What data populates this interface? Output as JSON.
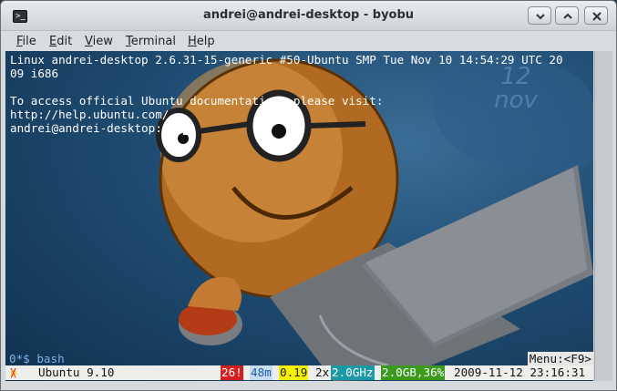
{
  "window": {
    "title": "andrei@andrei-desktop - byobu",
    "icon": "terminal-icon"
  },
  "menubar": {
    "items": [
      {
        "mnemonic": "F",
        "rest": "ile"
      },
      {
        "mnemonic": "E",
        "rest": "dit"
      },
      {
        "mnemonic": "V",
        "rest": "iew"
      },
      {
        "mnemonic": "T",
        "rest": "erminal"
      },
      {
        "mnemonic": "H",
        "rest": "elp"
      }
    ]
  },
  "terminal": {
    "lines": [
      "Linux andrei-desktop 2.6.31-15-generic #50-Ubuntu SMP Tue Nov 10 14:54:29 UTC 20",
      "09 i686",
      "",
      "To access official Ubuntu documentation, please visit:",
      "http://help.ubuntu.com/",
      "andrei@andrei-desktop:~$ "
    ],
    "wallpaper_text": "12 nov"
  },
  "statusbar": {
    "window_list": "0*$ bash",
    "menu_hint": "Menu:<F9>",
    "logo_left": "\\",
    "logo_mid": "o",
    "logo_right": "/",
    "distro": "Ubuntu 9.10",
    "updates": "26!",
    "memory_used": "48m",
    "load": "0.19",
    "cpu_count": "2x",
    "cpu_freq": "2.0GHz",
    "ram": "2.0GB,36%",
    "datetime": "2009-11-12 23:16:31"
  }
}
